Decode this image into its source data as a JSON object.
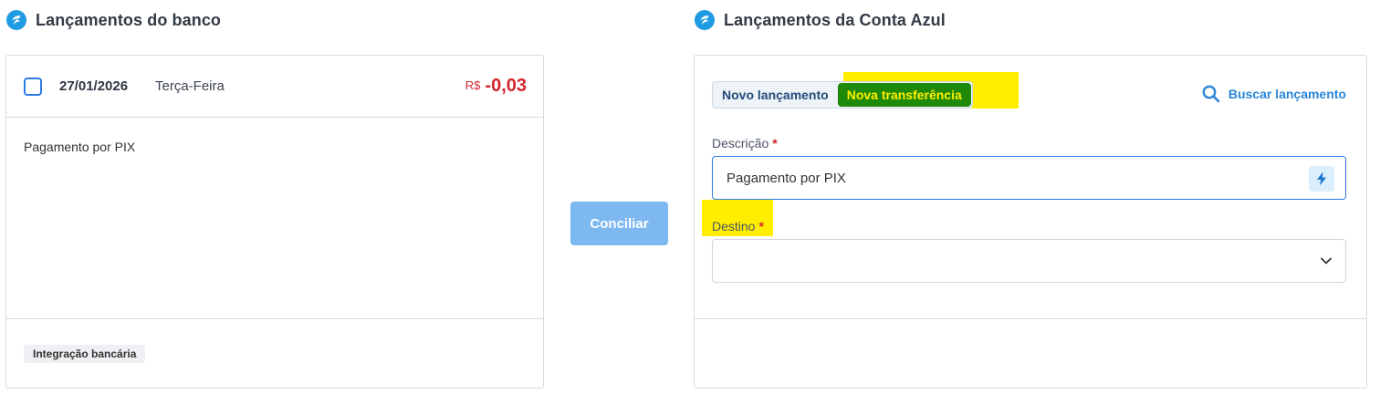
{
  "left_panel": {
    "title": "Lançamentos do banco",
    "transaction": {
      "date": "27/01/2026",
      "weekday": "Terça-Feira",
      "currency": "R$",
      "amount": "-0,03",
      "description": "Pagamento por PIX",
      "tag": "Integração bancária"
    }
  },
  "actions": {
    "conciliar_label": "Conciliar"
  },
  "right_panel": {
    "title": "Lançamentos da Conta Azul",
    "tabs": [
      {
        "label": "Novo lançamento",
        "active": false
      },
      {
        "label": "Nova transferência",
        "active": true
      }
    ],
    "search_label": "Buscar lançamento",
    "fields": {
      "descricao_label": "Descrição",
      "descricao_value": "Pagamento por PIX",
      "destino_label": "Destino",
      "destino_value": "",
      "required_mark": "*"
    }
  },
  "colors": {
    "accent_blue": "#2c7be5",
    "negative_red": "#d4262c",
    "highlight_yellow": "#ffee00",
    "active_tab_green": "#1f8a07",
    "conciliar_button": "#7db8f0"
  }
}
